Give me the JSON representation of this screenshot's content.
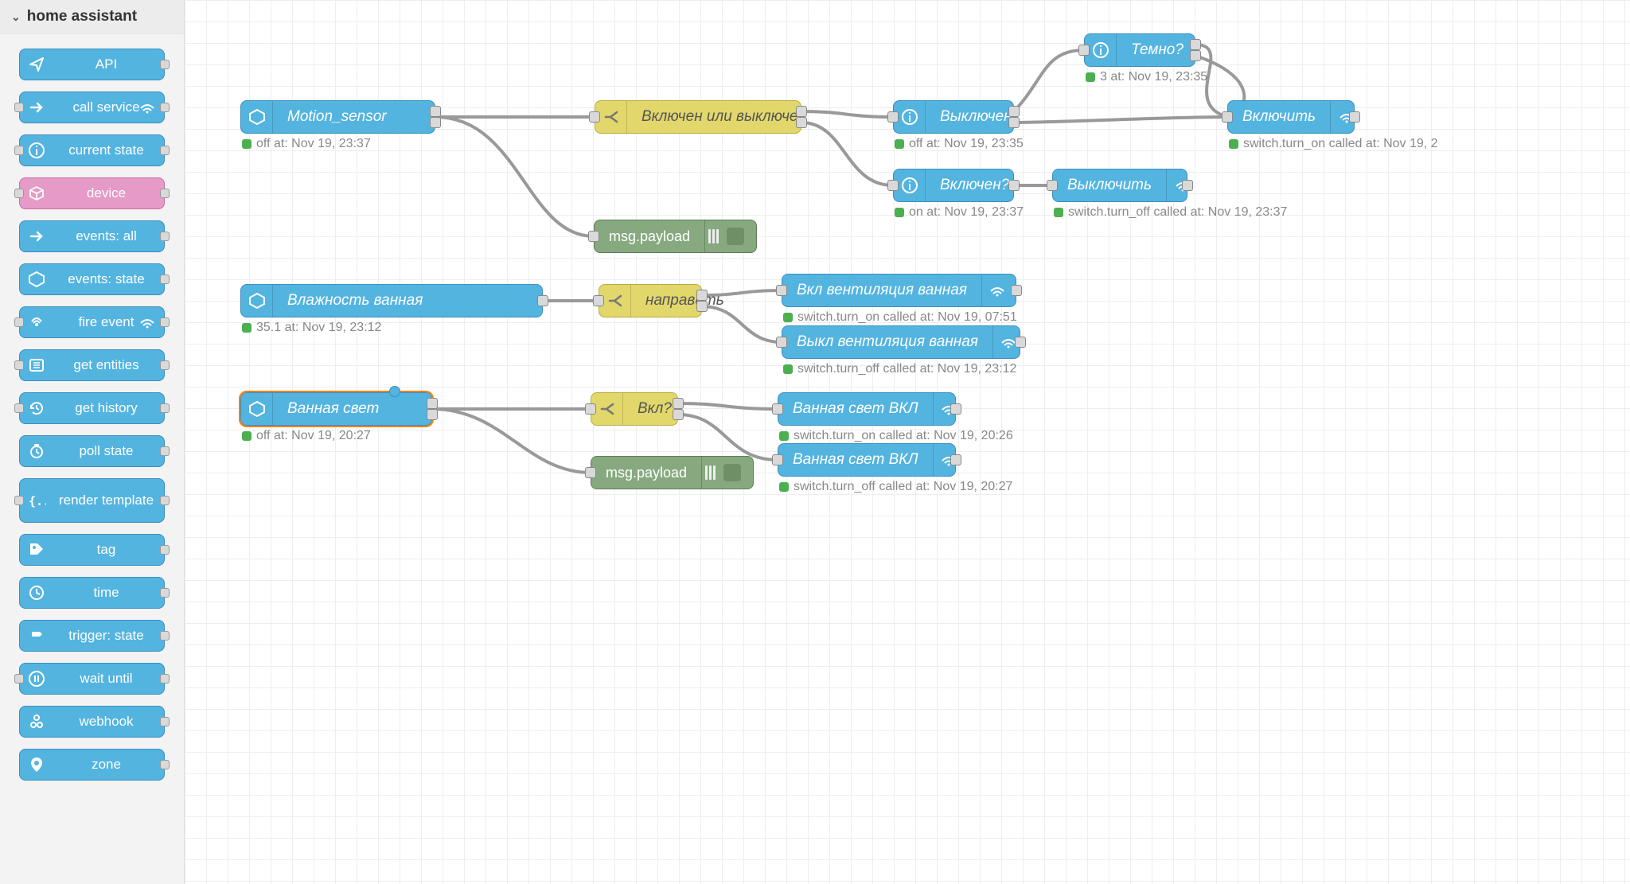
{
  "sidebar": {
    "title": "home assistant",
    "items": [
      {
        "label": "API",
        "icon": "paper-plane",
        "portLeft": false,
        "portRight": true,
        "rightIcon": false,
        "pink": false
      },
      {
        "label": "call service",
        "icon": "arrow-right",
        "portLeft": true,
        "portRight": true,
        "rightIcon": true,
        "pink": false
      },
      {
        "label": "current state",
        "icon": "info",
        "portLeft": true,
        "portRight": true,
        "rightIcon": false,
        "pink": false
      },
      {
        "label": "device",
        "icon": "cube",
        "portLeft": true,
        "portRight": true,
        "rightIcon": false,
        "pink": true
      },
      {
        "label": "events: all",
        "icon": "arrow-right",
        "portLeft": false,
        "portRight": true,
        "rightIcon": false,
        "pink": false
      },
      {
        "label": "events: state",
        "icon": "hex",
        "portLeft": false,
        "portRight": true,
        "rightIcon": false,
        "pink": false
      },
      {
        "label": "fire event",
        "icon": "broadcast",
        "portLeft": true,
        "portRight": true,
        "rightIcon": true,
        "pink": false
      },
      {
        "label": "get entities",
        "icon": "list",
        "portLeft": true,
        "portRight": true,
        "rightIcon": false,
        "pink": false
      },
      {
        "label": "get history",
        "icon": "history",
        "portLeft": true,
        "portRight": true,
        "rightIcon": false,
        "pink": false
      },
      {
        "label": "poll state",
        "icon": "timer",
        "portLeft": false,
        "portRight": true,
        "rightIcon": false,
        "pink": false
      },
      {
        "label": "render template",
        "icon": "brackets",
        "portLeft": true,
        "portRight": true,
        "rightIcon": false,
        "pink": false,
        "multiline": true
      },
      {
        "label": "tag",
        "icon": "tag",
        "portLeft": false,
        "portRight": true,
        "rightIcon": false,
        "pink": false
      },
      {
        "label": "time",
        "icon": "clock",
        "portLeft": false,
        "portRight": true,
        "rightIcon": false,
        "pink": false
      },
      {
        "label": "trigger: state",
        "icon": "signpost",
        "portLeft": false,
        "portRight": true,
        "rightIcon": false,
        "pink": false
      },
      {
        "label": "wait until",
        "icon": "pause",
        "portLeft": true,
        "portRight": true,
        "rightIcon": false,
        "pink": false
      },
      {
        "label": "webhook",
        "icon": "webhook",
        "portLeft": false,
        "portRight": true,
        "rightIcon": false,
        "pink": false
      },
      {
        "label": "zone",
        "icon": "pin",
        "portLeft": false,
        "portRight": true,
        "rightIcon": false,
        "pink": false
      }
    ]
  },
  "nodes": {
    "motion_sensor": {
      "label": "Motion_sensor",
      "status": "off at: Nov 19, 23:37"
    },
    "vkl_vykl": {
      "label": "Включен или выключен"
    },
    "vyklyuchen_q": {
      "label": "Выключен?",
      "status": "off at: Nov 19, 23:35"
    },
    "vklyuchen_q": {
      "label": "Включен?",
      "status": "on at: Nov 19, 23:37"
    },
    "temno_q": {
      "label": "Темно?",
      "status": "3 at: Nov 19, 23:35"
    },
    "vklyuchit": {
      "label": "Включить",
      "status": "switch.turn_on called at: Nov 19, 2"
    },
    "vyklyuchit": {
      "label": "Выключить",
      "status": "switch.turn_off called at: Nov 19, 23:37"
    },
    "debug1": {
      "label": "msg.payload"
    },
    "vlazh": {
      "label": "Влажность ванная",
      "status": "35.1 at: Nov 19, 23:12"
    },
    "napravit": {
      "label": "направить"
    },
    "vkl_vent": {
      "label": "Вкл вентиляция ванная",
      "status": "switch.turn_on called at: Nov 19, 07:51"
    },
    "vykl_vent": {
      "label": "Выкл вентиляция ванная",
      "status": "switch.turn_off called at: Nov 19, 23:12"
    },
    "vannaya_svet": {
      "label": "Ванная свет",
      "status": "off at: Nov 19, 20:27"
    },
    "vkl_q": {
      "label": "Вкл?"
    },
    "vannaya_vkl1": {
      "label": "Ванная свет ВКЛ",
      "status": "switch.turn_on called at: Nov 19, 20:26"
    },
    "vannaya_vkl2": {
      "label": "Ванная свет ВКЛ",
      "status": "switch.turn_off called at: Nov 19, 20:27"
    },
    "debug2": {
      "label": "msg.payload"
    }
  }
}
